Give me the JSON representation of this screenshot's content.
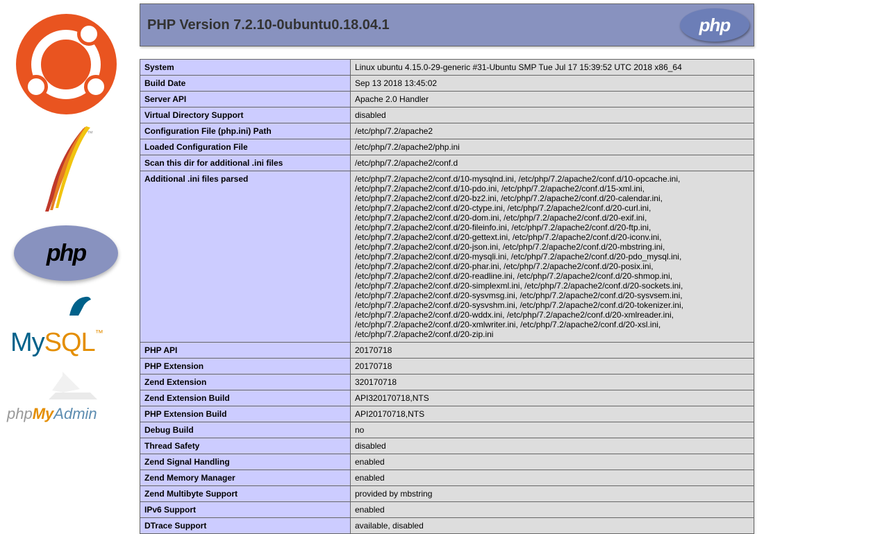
{
  "header": {
    "title": "PHP Version 7.2.10-0ubuntu0.18.04.1",
    "badge": "php"
  },
  "sidebar": {
    "php_text": "php",
    "mysql_my": "My",
    "mysql_sql": "SQL",
    "mysql_tm": "™",
    "pma_php": "php",
    "pma_my": "My",
    "pma_admin": "Admin"
  },
  "rows": [
    {
      "k": "System",
      "v": "Linux ubuntu 4.15.0-29-generic #31-Ubuntu SMP Tue Jul 17 15:39:52 UTC 2018 x86_64"
    },
    {
      "k": "Build Date",
      "v": "Sep 13 2018 13:45:02"
    },
    {
      "k": "Server API",
      "v": "Apache 2.0 Handler"
    },
    {
      "k": "Virtual Directory Support",
      "v": "disabled"
    },
    {
      "k": "Configuration File (php.ini) Path",
      "v": "/etc/php/7.2/apache2"
    },
    {
      "k": "Loaded Configuration File",
      "v": "/etc/php/7.2/apache2/php.ini"
    },
    {
      "k": "Scan this dir for additional .ini files",
      "v": "/etc/php/7.2/apache2/conf.d"
    },
    {
      "k": "Additional .ini files parsed",
      "v": "/etc/php/7.2/apache2/conf.d/10-mysqlnd.ini, /etc/php/7.2/apache2/conf.d/10-opcache.ini, /etc/php/7.2/apache2/conf.d/10-pdo.ini, /etc/php/7.2/apache2/conf.d/15-xml.ini, /etc/php/7.2/apache2/conf.d/20-bz2.ini, /etc/php/7.2/apache2/conf.d/20-calendar.ini, /etc/php/7.2/apache2/conf.d/20-ctype.ini, /etc/php/7.2/apache2/conf.d/20-curl.ini, /etc/php/7.2/apache2/conf.d/20-dom.ini, /etc/php/7.2/apache2/conf.d/20-exif.ini, /etc/php/7.2/apache2/conf.d/20-fileinfo.ini, /etc/php/7.2/apache2/conf.d/20-ftp.ini, /etc/php/7.2/apache2/conf.d/20-gettext.ini, /etc/php/7.2/apache2/conf.d/20-iconv.ini, /etc/php/7.2/apache2/conf.d/20-json.ini, /etc/php/7.2/apache2/conf.d/20-mbstring.ini, /etc/php/7.2/apache2/conf.d/20-mysqli.ini, /etc/php/7.2/apache2/conf.d/20-pdo_mysql.ini, /etc/php/7.2/apache2/conf.d/20-phar.ini, /etc/php/7.2/apache2/conf.d/20-posix.ini, /etc/php/7.2/apache2/conf.d/20-readline.ini, /etc/php/7.2/apache2/conf.d/20-shmop.ini, /etc/php/7.2/apache2/conf.d/20-simplexml.ini, /etc/php/7.2/apache2/conf.d/20-sockets.ini, /etc/php/7.2/apache2/conf.d/20-sysvmsg.ini, /etc/php/7.2/apache2/conf.d/20-sysvsem.ini, /etc/php/7.2/apache2/conf.d/20-sysvshm.ini, /etc/php/7.2/apache2/conf.d/20-tokenizer.ini, /etc/php/7.2/apache2/conf.d/20-wddx.ini, /etc/php/7.2/apache2/conf.d/20-xmlreader.ini, /etc/php/7.2/apache2/conf.d/20-xmlwriter.ini, /etc/php/7.2/apache2/conf.d/20-xsl.ini, /etc/php/7.2/apache2/conf.d/20-zip.ini"
    },
    {
      "k": "PHP API",
      "v": "20170718"
    },
    {
      "k": "PHP Extension",
      "v": "20170718"
    },
    {
      "k": "Zend Extension",
      "v": "320170718"
    },
    {
      "k": "Zend Extension Build",
      "v": "API320170718,NTS"
    },
    {
      "k": "PHP Extension Build",
      "v": "API20170718,NTS"
    },
    {
      "k": "Debug Build",
      "v": "no"
    },
    {
      "k": "Thread Safety",
      "v": "disabled"
    },
    {
      "k": "Zend Signal Handling",
      "v": "enabled"
    },
    {
      "k": "Zend Memory Manager",
      "v": "enabled"
    },
    {
      "k": "Zend Multibyte Support",
      "v": "provided by mbstring"
    },
    {
      "k": "IPv6 Support",
      "v": "enabled"
    },
    {
      "k": "DTrace Support",
      "v": "available, disabled"
    }
  ]
}
